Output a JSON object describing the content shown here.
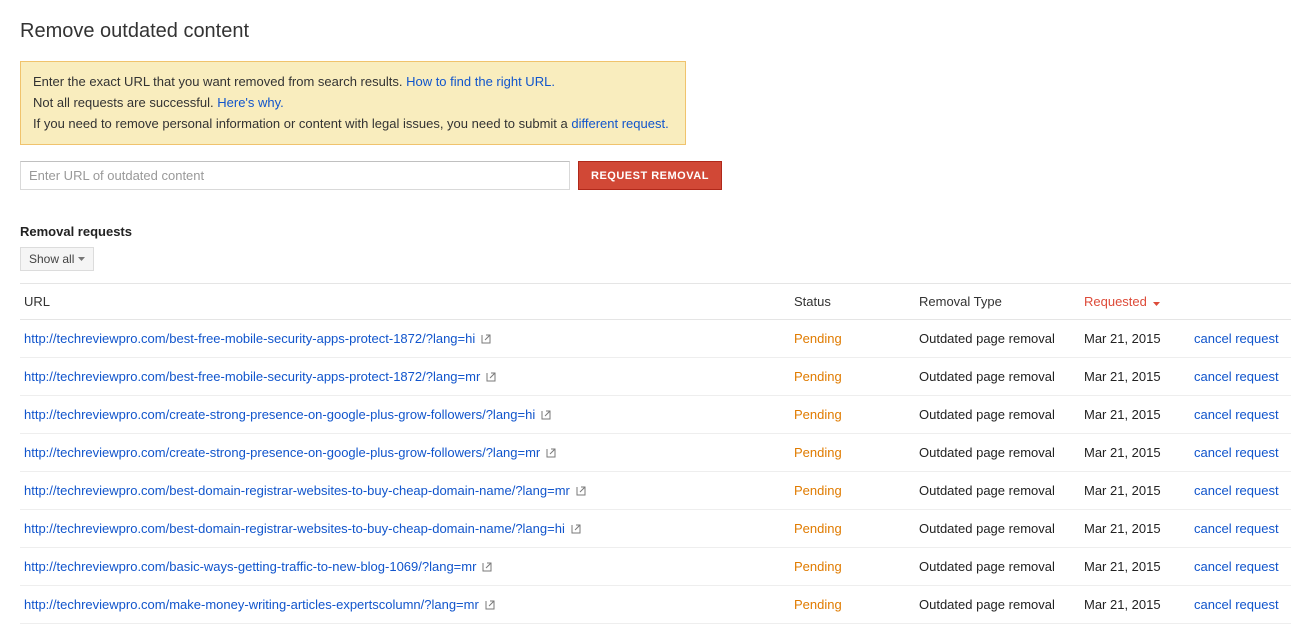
{
  "page_title": "Remove outdated content",
  "info": {
    "line1_a": "Enter the exact URL that you want removed from search results. ",
    "link1": "How to find the right URL.",
    "line2_a": "Not all requests are successful. ",
    "link2": "Here's why.",
    "line3_a": "If you need to remove personal information or content with legal issues, you need to submit a ",
    "link3": "different request."
  },
  "input": {
    "placeholder": "Enter URL of outdated content",
    "button": "Request Removal"
  },
  "section_title": "Removal requests",
  "filter_label": "Show all",
  "columns": {
    "url": "URL",
    "status": "Status",
    "type": "Removal Type",
    "requested": "Requested"
  },
  "cancel_label": "cancel request",
  "rows": [
    {
      "url": "http://techreviewpro.com/best-free-mobile-security-apps-protect-1872/?lang=hi",
      "status": "Pending",
      "type": "Outdated page removal",
      "requested": "Mar 21, 2015"
    },
    {
      "url": "http://techreviewpro.com/best-free-mobile-security-apps-protect-1872/?lang=mr",
      "status": "Pending",
      "type": "Outdated page removal",
      "requested": "Mar 21, 2015"
    },
    {
      "url": "http://techreviewpro.com/create-strong-presence-on-google-plus-grow-followers/?lang=hi",
      "status": "Pending",
      "type": "Outdated page removal",
      "requested": "Mar 21, 2015"
    },
    {
      "url": "http://techreviewpro.com/create-strong-presence-on-google-plus-grow-followers/?lang=mr",
      "status": "Pending",
      "type": "Outdated page removal",
      "requested": "Mar 21, 2015"
    },
    {
      "url": "http://techreviewpro.com/best-domain-registrar-websites-to-buy-cheap-domain-name/?lang=mr",
      "status": "Pending",
      "type": "Outdated page removal",
      "requested": "Mar 21, 2015"
    },
    {
      "url": "http://techreviewpro.com/best-domain-registrar-websites-to-buy-cheap-domain-name/?lang=hi",
      "status": "Pending",
      "type": "Outdated page removal",
      "requested": "Mar 21, 2015"
    },
    {
      "url": "http://techreviewpro.com/basic-ways-getting-traffic-to-new-blog-1069/?lang=mr",
      "status": "Pending",
      "type": "Outdated page removal",
      "requested": "Mar 21, 2015"
    },
    {
      "url": "http://techreviewpro.com/make-money-writing-articles-expertscolumn/?lang=mr",
      "status": "Pending",
      "type": "Outdated page removal",
      "requested": "Mar 21, 2015"
    }
  ]
}
